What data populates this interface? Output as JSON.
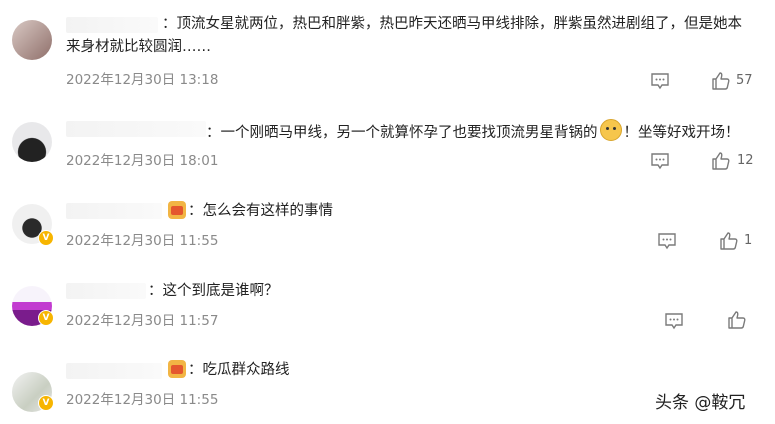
{
  "comments": [
    {
      "text_line1": "：顶流女星就两位，热巴和胖紫，热巴昨天还晒马甲线排除，胖紫虽然进剧组了，但是她本",
      "text_line2": "来身材就比较圆润……",
      "time": "2022年12月30日 13:18",
      "likes": "57",
      "verified": false,
      "emoji": null
    },
    {
      "text_before": "：一个刚晒马甲线，另一个就算怀孕了也要找顶流男星背锅的",
      "text_after": "！坐等好戏开场！",
      "emoji": "dog-icon",
      "time": "2022年12月30日 18:01",
      "likes": "12",
      "verified": false
    },
    {
      "text": "：怎么会有这样的事情",
      "emoji": "gift-icon",
      "time": "2022年12月30日 11:55",
      "likes": "1",
      "verified": true
    },
    {
      "text": "：这个到底是谁啊？",
      "time": "2022年12月30日 11:57",
      "likes": "",
      "verified": true,
      "emoji": null
    },
    {
      "text": "：吃瓜群众路线",
      "emoji": "gift-icon",
      "time": "2022年12月30日 11:55",
      "likes": "",
      "verified": true
    }
  ],
  "watermark": "头条 @鞍冗",
  "colors": {
    "time": "#8a8a8a",
    "icon": "#7a7a7a",
    "verified_badge": "#f7b500"
  }
}
